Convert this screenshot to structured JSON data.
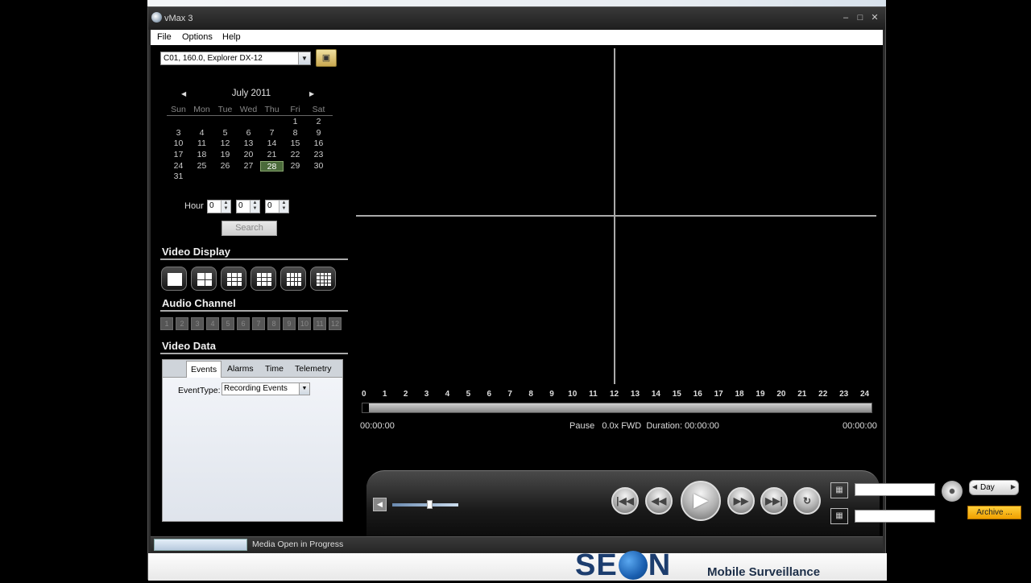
{
  "window": {
    "title": "vMax 3",
    "min_icon": "–",
    "max_icon": "□",
    "close_icon": "✕"
  },
  "menu": [
    "File",
    "Options",
    "Help"
  ],
  "device": {
    "selected": "C01, 160.0, Explorer DX-12"
  },
  "calendar": {
    "month": "July 2011",
    "prev": "◀",
    "next": "▶",
    "weekdays": [
      "Sun",
      "Mon",
      "Tue",
      "Wed",
      "Thu",
      "Fri",
      "Sat"
    ],
    "rows": [
      [
        "",
        "",
        "",
        "",
        "",
        "1",
        "2"
      ],
      [
        "3",
        "4",
        "5",
        "6",
        "7",
        "8",
        "9"
      ],
      [
        "10",
        "11",
        "12",
        "13",
        "14",
        "15",
        "16"
      ],
      [
        "17",
        "18",
        "19",
        "20",
        "21",
        "22",
        "23"
      ],
      [
        "24",
        "25",
        "26",
        "27",
        "28",
        "29",
        "30"
      ],
      [
        "31",
        "",
        "",
        "",
        "",
        "",
        ""
      ]
    ],
    "selected_day": "28"
  },
  "hour": {
    "label": "Hour",
    "values": [
      "0",
      "0",
      "0"
    ]
  },
  "search_label": "Search",
  "video_display": {
    "title": "Video Display",
    "layouts": [
      1,
      4,
      6,
      9,
      12,
      16
    ]
  },
  "audio_channel": {
    "title": "Audio Channel",
    "channels": [
      "1",
      "2",
      "3",
      "4",
      "5",
      "6",
      "7",
      "8",
      "9",
      "10",
      "11",
      "12"
    ]
  },
  "video_data": {
    "title": "Video Data",
    "tabs": [
      "Events",
      "Alarms",
      "Time",
      "Telemetry"
    ],
    "active_tab": "Events",
    "event_type_label": "EventType:",
    "event_type_value": "Recording Events"
  },
  "timeline": {
    "hours": [
      "0",
      "1",
      "2",
      "3",
      "4",
      "5",
      "6",
      "7",
      "8",
      "9",
      "10",
      "11",
      "12",
      "13",
      "14",
      "15",
      "16",
      "17",
      "18",
      "19",
      "20",
      "21",
      "22",
      "23",
      "24"
    ],
    "start_time": "00:00:00",
    "end_time": "00:00:00",
    "status": "Pause   0.0x FWD  Duration: 00:00:00",
    "position": 0
  },
  "controls": {
    "volume": 0.55,
    "day_label": "Day",
    "archive_label": "Archive ...",
    "icons": [
      "mute-icon",
      "skip-back-icon",
      "rewind-icon",
      "play-icon",
      "fast-forward-icon",
      "skip-forward-icon",
      "loop-icon",
      "clip-start-icon",
      "clip-end-icon",
      "disc-icon"
    ]
  },
  "status": {
    "text": "Media Open in Progress"
  },
  "brand": {
    "logo_prefix": "SE",
    "logo_suffix": "N",
    "tagline": "Mobile Surveillance"
  }
}
